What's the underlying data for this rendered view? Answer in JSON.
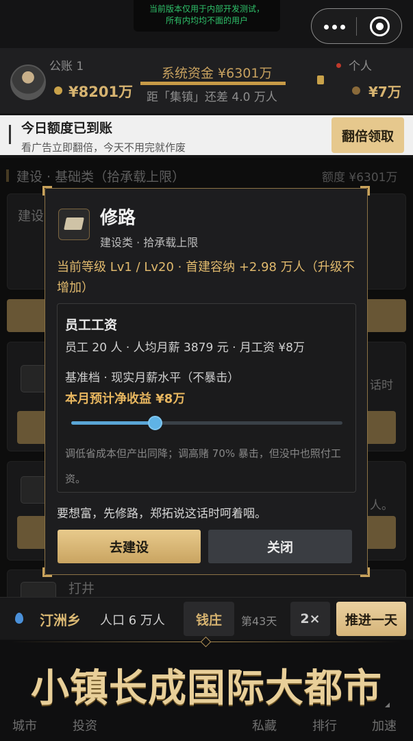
{
  "banner": {
    "text": "当前版本仅用于内部开发测试，\n所有内均均不面的用户"
  },
  "header": {
    "account_label": "公账 1",
    "account_money": "¥8201万",
    "system_funds": "系统资金 ¥6301万",
    "system_progress": 1.0,
    "distance_text": "距「集镇」还差 4.0 万人",
    "personal_label": "个人",
    "personal_money": "¥7万"
  },
  "quota": {
    "title": "今日额度已到账",
    "subtitle": "看广告立即翻倍，今天不用完就作废",
    "button": "翻倍领取"
  },
  "section": {
    "title": "建设 · 基础类（拾承载上限）",
    "quota": "额度 ¥6301万"
  },
  "background_cards": {
    "card1_label": "建设",
    "card_side_text1": "话时",
    "card_side_text2": "人。",
    "card_last_label": "打井"
  },
  "modal": {
    "title": "修路",
    "subtitle": "建设类 · 拾承载上限",
    "level_text": "当前等级 Lv1 / Lv20 · 首建容纳 +2.98 万人（升级不增加）",
    "wage_title": "员工工资",
    "wage_line": "员工 20 人 · 人均月薪 3879 元 · 月工资 ¥8万",
    "tier_line": "基准档 · 现实月薪水平（不暴击）",
    "profit_line": "本月预计净收益 ¥8万",
    "slider_value": 0.31,
    "hint": "调低省成本但产出同降；调高赌 70% 暴击，但没中也照付工资。",
    "quote": "要想富，先修路，郑拓说这话时呵着咽。",
    "build_button": "去建设",
    "close_button": "关闭"
  },
  "status": {
    "town": "汀洲乡",
    "population": "人口 6 万人",
    "bank": "钱庄",
    "day": "第43天",
    "speed": "2×",
    "advance": "推进一天"
  },
  "bottom": {
    "slogan": "小镇长成国际大都市",
    "nav": [
      "城市",
      "投资",
      "私藏",
      "排行",
      "加速"
    ]
  }
}
